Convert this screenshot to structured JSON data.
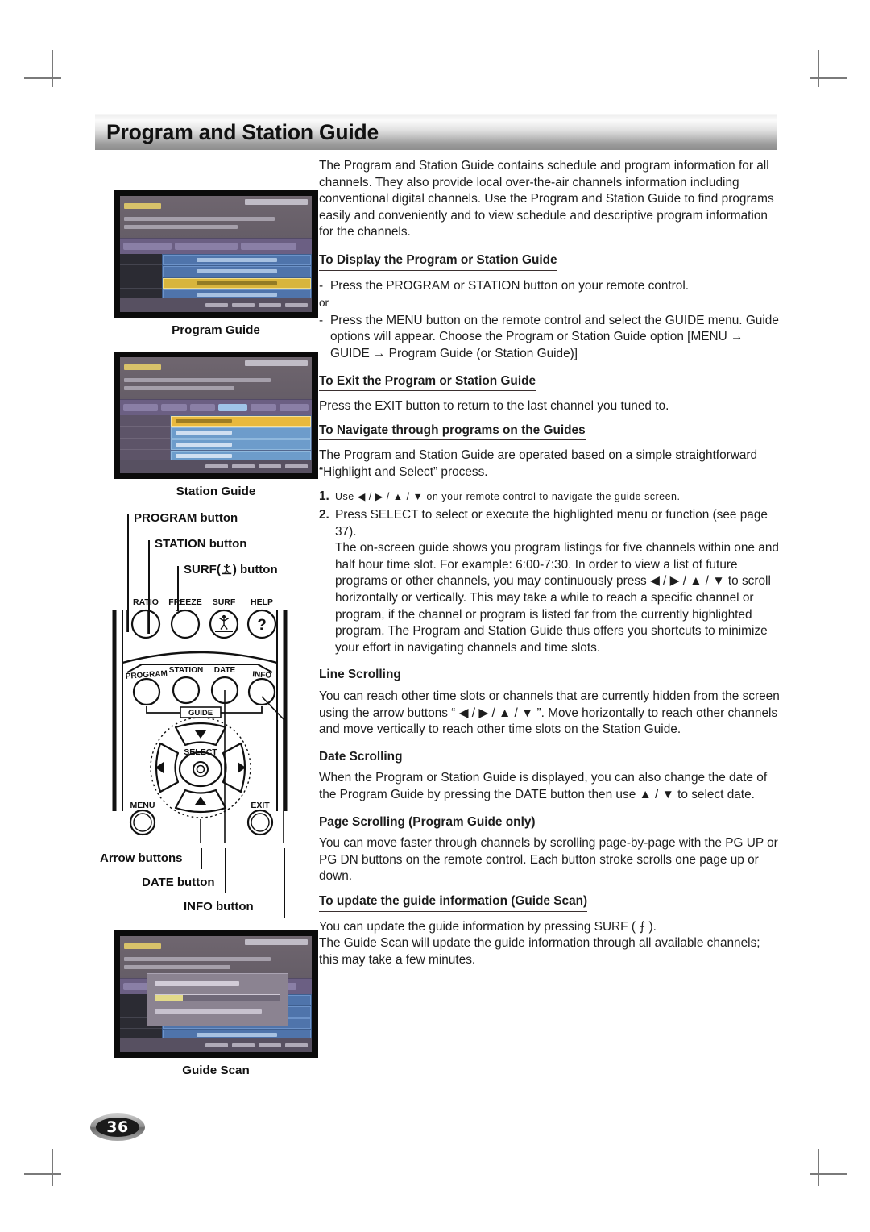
{
  "page": {
    "title": "Program and Station Guide",
    "number": "36"
  },
  "figures": {
    "program_guide_caption": "Program Guide",
    "station_guide_caption": "Station Guide",
    "guide_scan_caption": "Guide Scan"
  },
  "remote": {
    "callouts": {
      "program": "PROGRAM button",
      "station": "STATION button",
      "surf": "SURF(⨍) button",
      "arrow": "Arrow buttons",
      "date": "DATE button",
      "info": "INFO button"
    },
    "keys": {
      "ratio": "RATIO",
      "freeze": "FREEZE",
      "surf": "SURF",
      "help": "HELP",
      "help_glyph": "?",
      "program": "PROGRAM",
      "station": "STATION",
      "date": "DATE",
      "info": "INFO",
      "guide": "GUIDE",
      "select": "SELECT",
      "menu": "MENU",
      "exit": "EXIT"
    }
  },
  "content": {
    "intro": "The Program and Station Guide contains schedule and program information for all channels. They also provide local over-the-air channels information including conventional digital channels. Use the Program and Station Guide to find programs easily and conveniently and to view schedule and descriptive program information for the channels.",
    "s1": {
      "heading": "To Display the Program or Station Guide",
      "bullet_mark": "-",
      "item1": "Press the PROGRAM or STATION button on your remote control.",
      "or": "or",
      "item2": "Press the MENU button on the remote control and select the GUIDE menu. Guide options will appear. Choose the Program or Station Guide option [MENU → GUIDE → Program Guide (or Station Guide)]"
    },
    "s2": {
      "heading": "To Exit the Program or Station Guide",
      "body": "Press the EXIT button to return to the last channel you tuned to."
    },
    "s3": {
      "heading": "To Navigate through programs on the Guides",
      "body": "The Program and Station Guide are operated based on a simple straightforward “Highlight and Select” process.",
      "n1_mark": "1.",
      "n1": "Use ◀ / ▶ / ▲ / ▼ on your remote control to navigate the guide screen.",
      "n2_mark": "2.",
      "n2": "Press SELECT to select or execute the highlighted menu or function (see page 37).",
      "n2b": "The on-screen guide shows you program listings for five channels within one and half hour time slot. For example: 6:00-7:30. In order to view a list of future programs or other channels, you may continuously press ◀ / ▶ / ▲ / ▼ to scroll horizontally or vertically. This may take a while to reach a specific channel or program, if the channel or program is listed far from the currently highlighted program.  The Program and Station Guide thus offers you shortcuts to minimize your effort in navigating channels and time slots."
    },
    "s4": {
      "heading": "Line Scrolling",
      "body": "You can reach other time slots or channels that are currently hidden from the screen using the arrow buttons “ ◀ / ▶ / ▲ / ▼ ”. Move horizontally to reach other channels and move vertically to reach other time slots on the Station Guide."
    },
    "s5": {
      "heading": "Date Scrolling",
      "body": "When the Program or Station Guide is displayed, you can also change the date of the Program Guide by pressing the DATE button then use ▲ / ▼ to select date."
    },
    "s6": {
      "heading": "Page Scrolling (Program Guide only)",
      "body": "You can move faster through channels by scrolling page-by-page with the PG UP or PG DN buttons on the remote control. Each button stroke scrolls one page up or down."
    },
    "s7": {
      "heading": "To update the guide information (Guide Scan)",
      "body1": "You can update the guide information by pressing SURF ( ⨍ ).",
      "body2": "The Guide Scan will update the guide information through all available channels; this may take a few minutes."
    }
  }
}
